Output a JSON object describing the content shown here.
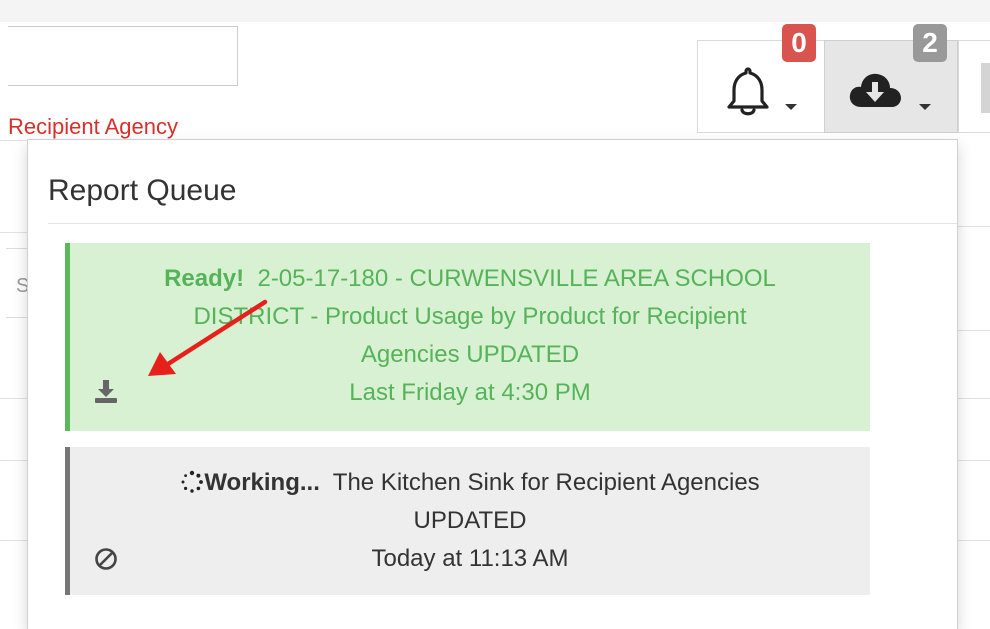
{
  "page": {
    "recipient_link": "Recipient Agency",
    "search_fragment_letter": "S"
  },
  "navbar": {
    "notifications": {
      "icon": "bell-icon",
      "badge_count": "0",
      "badge_color": "#d9534f"
    },
    "downloads": {
      "icon": "cloud-download-icon",
      "badge_count": "2",
      "badge_color": "#999999"
    }
  },
  "report_queue": {
    "title": "Report Queue",
    "items": [
      {
        "status": "Ready!",
        "text_lines": [
          "2-05-17-180 - CURWENSVILLE AREA SCHOOL",
          "DISTRICT - Product Usage by Product for Recipient",
          "Agencies UPDATED"
        ],
        "timestamp": "Last Friday at 4:30 PM",
        "action_icon": "download-icon",
        "accent_color": "#5cb85c"
      },
      {
        "status": "Working...",
        "text_lines": [
          "The Kitchen Sink for Recipient Agencies",
          "UPDATED"
        ],
        "timestamp": "Today at 11:13 AM",
        "action_icon": "cancel-icon",
        "accent_color": "#777777"
      }
    ]
  },
  "annotation": {
    "arrow_color": "#e8201c"
  }
}
